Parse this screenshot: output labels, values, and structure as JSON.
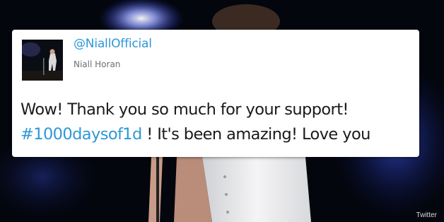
{
  "background": {
    "description_colors": {
      "sky": "#05070f",
      "light": "#3b4dbe",
      "shirt": "#e9e9ea",
      "skin": "#c79a86"
    }
  },
  "tweet": {
    "handle": "@NiallOfficial",
    "display_name": "Niall Horan",
    "text_line1": "Wow! Thank you so much for your support!",
    "hashtag": "#1000daysof1d",
    "text_line2_rest": " ! It's been amazing! Love you",
    "accent_color": "#2d97d8",
    "avatar_icon": "concert-stage-avatar"
  },
  "credit": "Twitter"
}
